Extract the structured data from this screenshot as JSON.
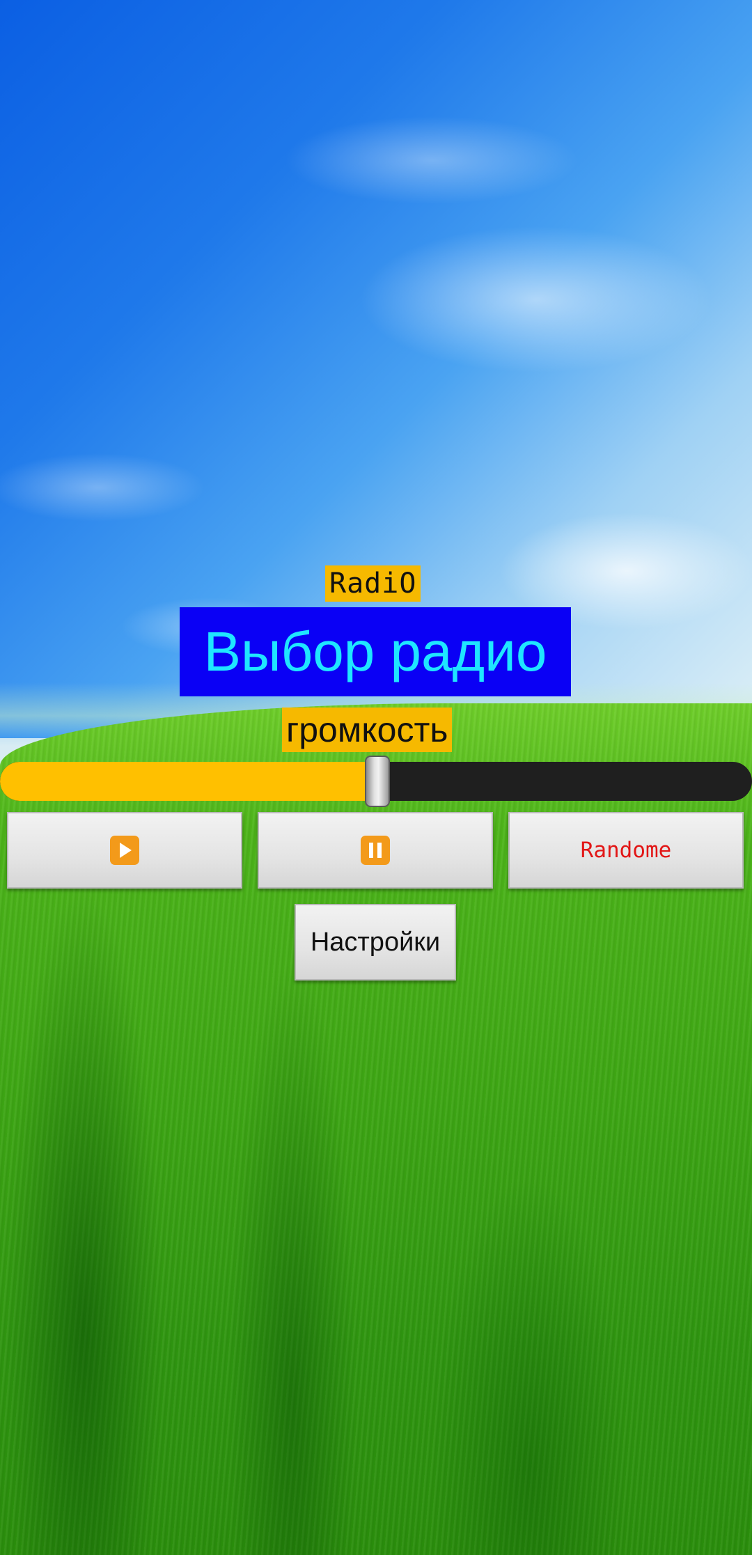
{
  "app": {
    "title_label": "RadiO",
    "station_button_label": "Выбор радио",
    "volume_label": "громкость",
    "volume_level_percent": 50
  },
  "controls": {
    "play_icon": "play-icon",
    "pause_icon": "pause-icon",
    "random_label": "Randome",
    "settings_label": "Настройки"
  },
  "colors": {
    "title_bg": "#f6b900",
    "station_bg": "#0a00f5",
    "station_text": "#1fe6ff",
    "slider_fill": "#ffc000",
    "slider_track": "#1f1f1f",
    "random_text": "#e21616",
    "icon_bg": "#f39a1a"
  }
}
